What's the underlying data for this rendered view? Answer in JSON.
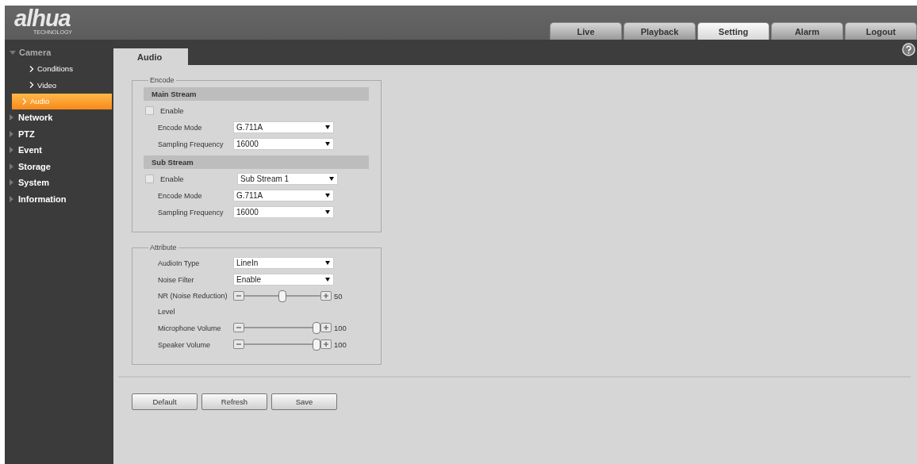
{
  "logo": {
    "brand": "alhua",
    "tagline": "TECHNOLOGY"
  },
  "top_tabs": [
    {
      "label": "Live",
      "selected": false
    },
    {
      "label": "Playback",
      "selected": false
    },
    {
      "label": "Setting",
      "selected": true
    },
    {
      "label": "Alarm",
      "selected": false
    },
    {
      "label": "Logout",
      "selected": false
    }
  ],
  "sidebar": {
    "items": [
      {
        "label": "Camera",
        "expanded": true,
        "children": [
          {
            "label": "Conditions",
            "selected": false
          },
          {
            "label": "Video",
            "selected": false
          },
          {
            "label": "Audio",
            "selected": true
          }
        ]
      },
      {
        "label": "Network",
        "expanded": false
      },
      {
        "label": "PTZ",
        "expanded": false
      },
      {
        "label": "Event",
        "expanded": false
      },
      {
        "label": "Storage",
        "expanded": false
      },
      {
        "label": "System",
        "expanded": false
      },
      {
        "label": "Information",
        "expanded": false
      }
    ]
  },
  "page_tab": {
    "label": "Audio"
  },
  "sections": [
    {
      "legend": "Encode",
      "groups": [
        {
          "heading": "Main Stream",
          "rows": [
            {
              "kind": "checkbox",
              "label": "Enable",
              "checked": false
            },
            {
              "kind": "select",
              "label": "Encode Mode",
              "value": "G.711A"
            },
            {
              "kind": "select",
              "label": "Sampling Frequency",
              "value": "16000"
            }
          ]
        },
        {
          "heading": "Sub Stream",
          "rows": [
            {
              "kind": "checkbox_select",
              "label": "Enable",
              "checked": false,
              "value": "Sub Stream 1"
            },
            {
              "kind": "select",
              "label": "Encode Mode",
              "value": "G.711A"
            },
            {
              "kind": "select",
              "label": "Sampling Frequency",
              "value": "16000"
            }
          ]
        }
      ]
    },
    {
      "legend": "Attribute",
      "groups": [
        {
          "rows": [
            {
              "kind": "select",
              "label": "AudioIn Type",
              "value": "LineIn"
            },
            {
              "kind": "select",
              "label": "Noise Filter",
              "value": "Enable"
            },
            {
              "kind": "slider",
              "label": "NR (Noise Reduction) Level",
              "level": 0.5,
              "reading": "50"
            },
            {
              "kind": "slider",
              "label": "Microphone Volume",
              "level": 1.0,
              "reading": "100"
            },
            {
              "kind": "slider",
              "label": "Speaker Volume",
              "level": 1.0,
              "reading": "100"
            }
          ]
        }
      ]
    }
  ],
  "buttons": [
    "Default",
    "Refresh",
    "Save"
  ]
}
